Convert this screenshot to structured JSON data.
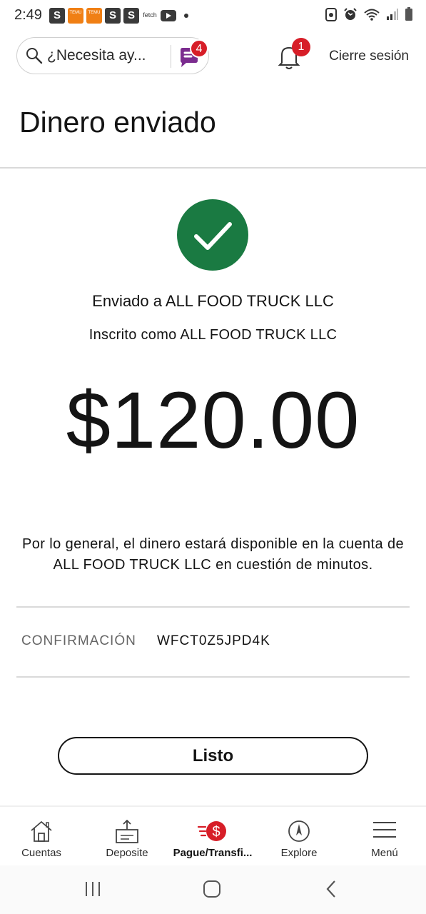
{
  "status_bar": {
    "time": "2:49",
    "app_icons": [
      "S",
      "temu",
      "temu",
      "S",
      "S",
      "fetch",
      "youtube"
    ],
    "fetch_label": "fetch",
    "temu_label": "TEMU"
  },
  "header": {
    "search": {
      "placeholder": "¿Necesita ay..."
    },
    "chat_badge": "4",
    "notifications_badge": "1",
    "logout_label": "Cierre sesión"
  },
  "page": {
    "title": "Dinero enviado",
    "sent_to": "Enviado a ALL FOOD TRUCK LLC",
    "enrolled_as": "Inscrito como ALL FOOD TRUCK LLC",
    "amount": "$120.00",
    "availability_note": "Por lo general, el dinero estará disponible en la cuenta de ALL FOOD TRUCK LLC en cuestión de minutos.",
    "confirmation_label": "CONFIRMACIÓN",
    "confirmation_value": "WFCT0Z5JPD4K",
    "done_button": "Listo"
  },
  "bottom_nav": [
    {
      "label": "Cuentas",
      "icon": "home-icon",
      "active": false
    },
    {
      "label": "Deposite",
      "icon": "deposit-icon",
      "active": false
    },
    {
      "label": "Pague/Transfi...",
      "icon": "pay-transfer-icon",
      "active": true
    },
    {
      "label": "Explore",
      "icon": "compass-icon",
      "active": false
    },
    {
      "label": "Menú",
      "icon": "hamburger-menu-icon",
      "active": false
    }
  ],
  "colors": {
    "success_green": "#1a7a42",
    "brand_red": "#d71e28",
    "chat_purple": "#7b2c8f"
  }
}
